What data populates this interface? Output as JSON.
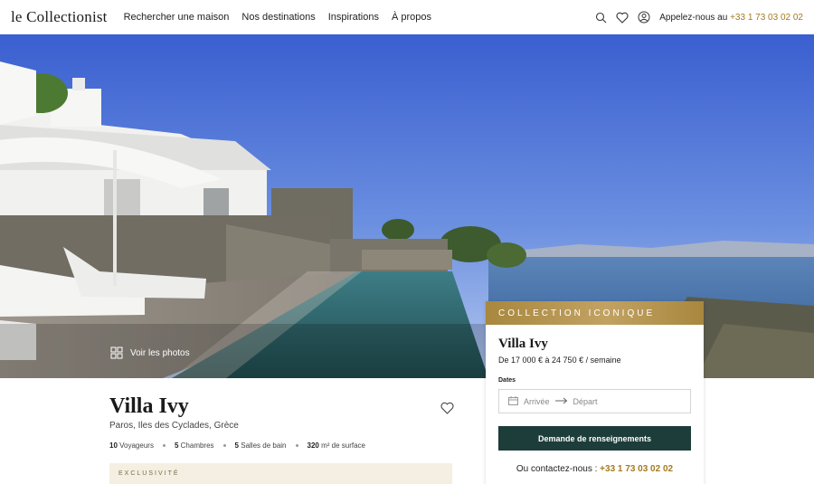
{
  "nav": {
    "logo": "le Collectionist",
    "links": [
      "Rechercher une maison",
      "Nos destinations",
      "Inspirations",
      "À propos"
    ],
    "call_label": "Appelez-nous au",
    "phone": "+33 1 73 03 02 02",
    "icons": [
      "search-icon",
      "heart-icon",
      "user-icon"
    ]
  },
  "hero": {
    "photos_label": "Voir les photos",
    "icon": "grid-icon"
  },
  "listing": {
    "title": "Villa Ivy",
    "location": "Paros, Iles des Cyclades, Grèce",
    "stats": [
      {
        "value": "10",
        "label": "Voyageurs"
      },
      {
        "value": "5",
        "label": "Chambres"
      },
      {
        "value": "5",
        "label": "Salles de bain"
      },
      {
        "value": "320",
        "label": "m² de surface"
      }
    ],
    "exclusivity": "EXCLUSIVITÉ"
  },
  "booking": {
    "collection": "COLLECTION ICONIQUE",
    "title": "Villa Ivy",
    "price": "De 17 000 € à 24 750 € / semaine",
    "dates_label": "Dates",
    "arrival": "Arrivée",
    "departure": "Départ",
    "cta": "Demande de renseignements",
    "contact_label": "Ou contactez-nous :",
    "phone": "+33 1 73 03 02 02"
  },
  "colors": {
    "accent_gold": "#a57b1f",
    "cta_green": "#1d3d3a",
    "collection_band": "#b4944f"
  }
}
